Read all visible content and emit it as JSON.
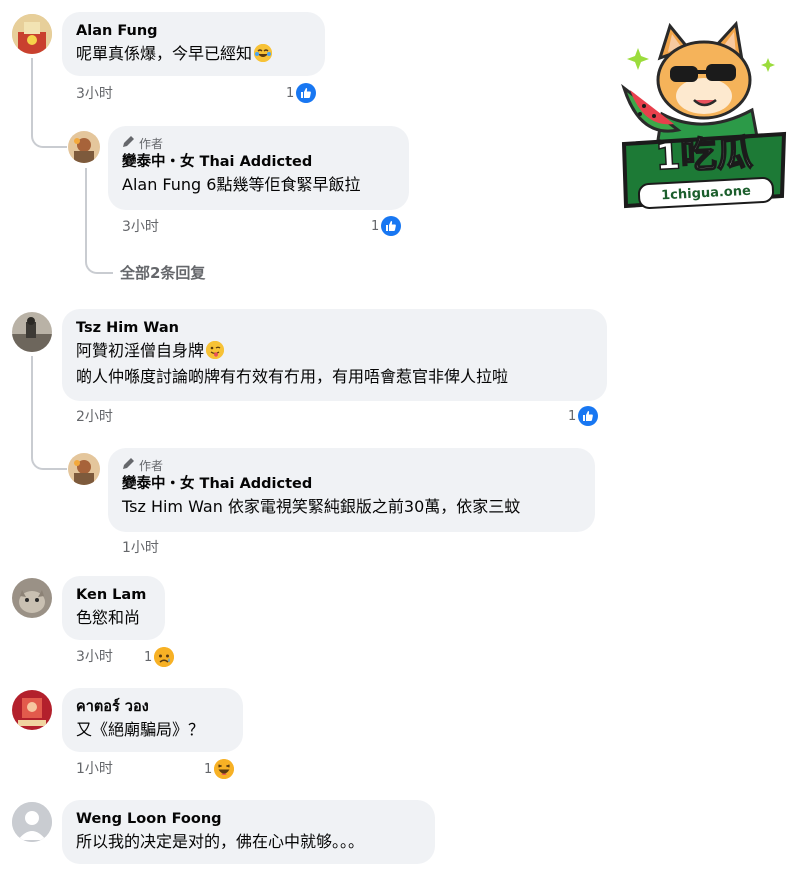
{
  "comments": [
    {
      "name": "Alan Fung",
      "text": "呢單真係爆，今早已經知",
      "time": "3小时",
      "reaction_count": "1",
      "reply": {
        "author_label": "作者",
        "name": "變泰中・女 Thai Addicted",
        "text": "Alan Fung 6點幾等佢食緊早飯拉",
        "time": "3小时",
        "reaction_count": "1"
      },
      "view_replies": "全部2条回复"
    },
    {
      "name": "Tsz Him Wan",
      "line1": "阿贊初淫僧自身牌",
      "line2": "啲人仲喺度討論啲牌有冇效有冇用，有用唔會惹官非俾人拉啦",
      "time": "2小时",
      "reaction_count": "1",
      "reply": {
        "author_label": "作者",
        "name": "變泰中・女 Thai Addicted",
        "text": "Tsz Him Wan 依家電視笑緊純銀版之前30萬，依家三蚊",
        "time": "1小时"
      }
    },
    {
      "name": "Ken Lam",
      "text": "色慾和尚",
      "time": "3小时",
      "reaction_count": "1"
    },
    {
      "name": "คาตอร์ วอง",
      "text": "又《絕廟騙局》？",
      "time": "1小时",
      "reaction_count": "1"
    },
    {
      "name": "Weng Loon Foong",
      "text": "所以我的决定是对的，佛在心中就够。。。"
    }
  ],
  "watermark": {
    "brand": "1吃瓜",
    "url": "1chigua.one"
  },
  "colors": {
    "bubble": "#f0f2f5",
    "like_blue": "#1877f2",
    "meta_gray": "#65676b",
    "logo_green": "#1f8a3a"
  }
}
